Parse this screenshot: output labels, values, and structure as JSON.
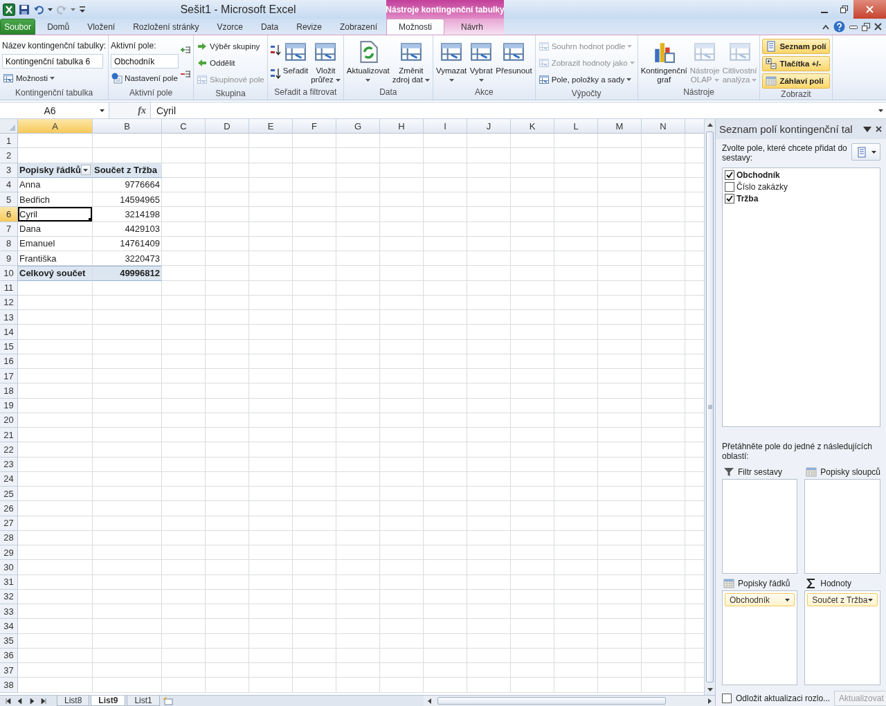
{
  "window": {
    "title": "Sešit1  -  Microsoft Excel",
    "contextual_group": "Nástroje kontingenční tabulky"
  },
  "ribbon_tabs": [
    {
      "label": "Soubor",
      "kind": "file",
      "selected": false
    },
    {
      "label": "Domů",
      "kind": "tab",
      "selected": false
    },
    {
      "label": "Vložení",
      "kind": "tab",
      "selected": false
    },
    {
      "label": "Rozložení stránky",
      "kind": "tab",
      "selected": false
    },
    {
      "label": "Vzorce",
      "kind": "tab",
      "selected": false
    },
    {
      "label": "Data",
      "kind": "tab",
      "selected": false
    },
    {
      "label": "Revize",
      "kind": "tab",
      "selected": false
    },
    {
      "label": "Zobrazení",
      "kind": "tab",
      "selected": false
    },
    {
      "label": "Možnosti",
      "kind": "contextual",
      "selected": true
    },
    {
      "label": "Návrh",
      "kind": "contextual",
      "selected": false
    }
  ],
  "ribbon_groups": [
    {
      "title": "Kontingenční tabulka",
      "columns": [
        [
          {
            "kind": "label",
            "text": "Název kontingenční tabulky:"
          },
          {
            "kind": "field",
            "value": "Kontingenční tabulka 6"
          },
          {
            "kind": "small",
            "label": "Možnosti",
            "dropdown": true,
            "disabled": false
          }
        ]
      ]
    },
    {
      "title": "Aktivní pole",
      "columns": [
        [
          {
            "kind": "label",
            "text": "Aktivní pole:"
          },
          {
            "kind": "field",
            "value": "Obchodník"
          },
          {
            "kind": "small",
            "label": "Nastavení pole",
            "dropdown": false,
            "disabled": false
          }
        ],
        [
          {
            "kind": "icon",
            "disabled": false
          },
          {
            "kind": "icon",
            "disabled": false
          }
        ]
      ]
    },
    {
      "title": "Skupina",
      "columns": [
        [
          {
            "kind": "small",
            "label": "Výběr skupiny",
            "dropdown": false,
            "disabled": false
          },
          {
            "kind": "small",
            "label": "Oddělit",
            "dropdown": false,
            "disabled": false
          },
          {
            "kind": "small",
            "label": "Skupinové pole",
            "dropdown": false,
            "disabled": true
          }
        ]
      ]
    },
    {
      "title": "Seřadit a filtrovat",
      "columns": [
        [
          {
            "kind": "icon",
            "disabled": false
          },
          {
            "kind": "icon",
            "disabled": false
          }
        ],
        [
          {
            "kind": "large",
            "lines": [
              "Seřadit"
            ],
            "dropdown": false,
            "disabled": false
          }
        ],
        [
          {
            "kind": "large",
            "lines": [
              "Vložit",
              "průřez"
            ],
            "dropdown": true,
            "disabled": false
          }
        ]
      ]
    },
    {
      "title": "Data",
      "columns": [
        [
          {
            "kind": "large",
            "lines": [
              "Aktualizovat"
            ],
            "dropdown": true,
            "disabled": false
          }
        ],
        [
          {
            "kind": "large",
            "lines": [
              "Změnit",
              "zdroj dat"
            ],
            "dropdown": true,
            "disabled": false
          }
        ]
      ]
    },
    {
      "title": "Akce",
      "columns": [
        [
          {
            "kind": "large",
            "lines": [
              "Vymazat"
            ],
            "dropdown": true,
            "disabled": false
          }
        ],
        [
          {
            "kind": "large",
            "lines": [
              "Vybrat"
            ],
            "dropdown": true,
            "disabled": false
          }
        ],
        [
          {
            "kind": "large",
            "lines": [
              "Přesunout"
            ],
            "dropdown": false,
            "disabled": false
          }
        ]
      ]
    },
    {
      "title": "Výpočty",
      "columns": [
        [
          {
            "kind": "small",
            "label": "Souhrn hodnot podle",
            "dropdown": true,
            "disabled": true
          },
          {
            "kind": "small",
            "label": "Zobrazit hodnoty jako",
            "dropdown": true,
            "disabled": true
          },
          {
            "kind": "small",
            "label": "Pole, položky a sady",
            "dropdown": true,
            "disabled": false
          }
        ]
      ]
    },
    {
      "title": "Nástroje",
      "columns": [
        [
          {
            "kind": "large",
            "lines": [
              "Kontingenční",
              "graf"
            ],
            "dropdown": false,
            "disabled": false
          }
        ],
        [
          {
            "kind": "large",
            "lines": [
              "Nástroje",
              "OLAP"
            ],
            "dropdown": true,
            "disabled": true
          }
        ],
        [
          {
            "kind": "large",
            "lines": [
              "Citlivostní",
              "analýza"
            ],
            "dropdown": true,
            "disabled": true
          }
        ]
      ]
    },
    {
      "title": "Zobrazit",
      "columns": [
        [
          {
            "kind": "toggle",
            "label": "Seznam polí",
            "on": true
          },
          {
            "kind": "toggle",
            "label": "Tlačítka +/-",
            "on": true
          },
          {
            "kind": "toggle",
            "label": "Záhlaví polí",
            "on": true
          }
        ]
      ]
    }
  ],
  "formula_bar": {
    "name_box": "A6",
    "function_label": "fx",
    "content": "Cyril"
  },
  "sheet": {
    "columns": [
      {
        "label": "A",
        "selected": true
      },
      {
        "label": "B",
        "selected": false
      },
      {
        "label": "C",
        "selected": false
      },
      {
        "label": "D",
        "selected": false
      },
      {
        "label": "E",
        "selected": false
      },
      {
        "label": "F",
        "selected": false
      },
      {
        "label": "G",
        "selected": false
      },
      {
        "label": "H",
        "selected": false
      },
      {
        "label": "I",
        "selected": false
      },
      {
        "label": "J",
        "selected": false
      },
      {
        "label": "K",
        "selected": false
      },
      {
        "label": "L",
        "selected": false
      },
      {
        "label": "M",
        "selected": false
      },
      {
        "label": "N",
        "selected": false
      }
    ],
    "rows": [
      {
        "number": "1",
        "selected": false,
        "kind": "blank"
      },
      {
        "number": "2",
        "selected": false,
        "kind": "blank"
      },
      {
        "number": "3",
        "selected": false,
        "kind": "pivot_header",
        "cells": [
          {
            "text": "Popisky řádků",
            "active": false,
            "filter": true
          },
          {
            "text": "Součet z Tržba",
            "active": false,
            "filter": false
          }
        ]
      },
      {
        "number": "4",
        "selected": false,
        "kind": "pivot_item",
        "cells": [
          {
            "text": "Anna",
            "active": false
          },
          {
            "text": "9776664",
            "active": false
          }
        ]
      },
      {
        "number": "5",
        "selected": false,
        "kind": "pivot_item",
        "cells": [
          {
            "text": "Bedřich",
            "active": false
          },
          {
            "text": "14594965",
            "active": false
          }
        ]
      },
      {
        "number": "6",
        "selected": true,
        "kind": "pivot_item",
        "cells": [
          {
            "text": "Cyril",
            "active": true
          },
          {
            "text": "3214198",
            "active": false
          }
        ]
      },
      {
        "number": "7",
        "selected": false,
        "kind": "pivot_item",
        "cells": [
          {
            "text": "Dana",
            "active": false
          },
          {
            "text": "4429103",
            "active": false
          }
        ]
      },
      {
        "number": "8",
        "selected": false,
        "kind": "pivot_item",
        "cells": [
          {
            "text": "Emanuel",
            "active": false
          },
          {
            "text": "14761409",
            "active": false
          }
        ]
      },
      {
        "number": "9",
        "selected": false,
        "kind": "pivot_item",
        "cells": [
          {
            "text": "Františka",
            "active": false
          },
          {
            "text": "3220473",
            "active": false
          }
        ]
      },
      {
        "number": "10",
        "selected": false,
        "kind": "pivot_total",
        "cells": [
          {
            "text": "Celkový součet",
            "active": false
          },
          {
            "text": "49996812",
            "active": false
          }
        ]
      },
      {
        "number": "11",
        "selected": false,
        "kind": "blank"
      },
      {
        "number": "12",
        "selected": false,
        "kind": "blank"
      },
      {
        "number": "13",
        "selected": false,
        "kind": "blank"
      },
      {
        "number": "14",
        "selected": false,
        "kind": "blank"
      },
      {
        "number": "15",
        "selected": false,
        "kind": "blank"
      },
      {
        "number": "16",
        "selected": false,
        "kind": "blank"
      },
      {
        "number": "17",
        "selected": false,
        "kind": "blank"
      },
      {
        "number": "18",
        "selected": false,
        "kind": "blank"
      },
      {
        "number": "19",
        "selected": false,
        "kind": "blank"
      },
      {
        "number": "20",
        "selected": false,
        "kind": "blank"
      },
      {
        "number": "21",
        "selected": false,
        "kind": "blank"
      },
      {
        "number": "22",
        "selected": false,
        "kind": "blank"
      },
      {
        "number": "23",
        "selected": false,
        "kind": "blank"
      },
      {
        "number": "24",
        "selected": false,
        "kind": "blank"
      },
      {
        "number": "25",
        "selected": false,
        "kind": "blank"
      },
      {
        "number": "26",
        "selected": false,
        "kind": "blank"
      },
      {
        "number": "27",
        "selected": false,
        "kind": "blank"
      },
      {
        "number": "28",
        "selected": false,
        "kind": "blank"
      },
      {
        "number": "29",
        "selected": false,
        "kind": "blank"
      },
      {
        "number": "30",
        "selected": false,
        "kind": "blank"
      },
      {
        "number": "31",
        "selected": false,
        "kind": "blank"
      },
      {
        "number": "32",
        "selected": false,
        "kind": "blank"
      },
      {
        "number": "33",
        "selected": false,
        "kind": "blank"
      },
      {
        "number": "34",
        "selected": false,
        "kind": "blank"
      },
      {
        "number": "35",
        "selected": false,
        "kind": "blank"
      },
      {
        "number": "36",
        "selected": false,
        "kind": "blank"
      },
      {
        "number": "37",
        "selected": false,
        "kind": "blank"
      },
      {
        "number": "38",
        "selected": false,
        "kind": "blank"
      }
    ]
  },
  "sheet_tabs": [
    {
      "label": "List8",
      "selected": false
    },
    {
      "label": "List9",
      "selected": true
    },
    {
      "label": "List1",
      "selected": false
    }
  ],
  "field_pane": {
    "title": "Seznam polí kontingenční tal",
    "instruction": "Zvolte pole, které chcete přidat do sestavy:",
    "fields": [
      {
        "label": "Obchodník",
        "checked": true
      },
      {
        "label": "Číslo zakázky",
        "checked": false
      },
      {
        "label": "Tržba",
        "checked": true
      }
    ],
    "drag_hint": "Přetáhněte pole do jedné z následujících oblastí:",
    "areas": [
      {
        "kind": "filter",
        "label": "Filtr sestavy"
      },
      {
        "kind": "columns",
        "label": "Popisky sloupců"
      },
      {
        "kind": "rows",
        "label": "Popisky řádků",
        "items": [
          "Obchodník"
        ]
      },
      {
        "kind": "values",
        "label": "Hodnoty",
        "items": [
          "Součet z Tržba"
        ]
      }
    ],
    "defer_update": {
      "label": "Odložit aktualizaci rozlo...",
      "checked": false
    },
    "update_button": {
      "label": "Aktualizovat",
      "disabled": true
    }
  }
}
